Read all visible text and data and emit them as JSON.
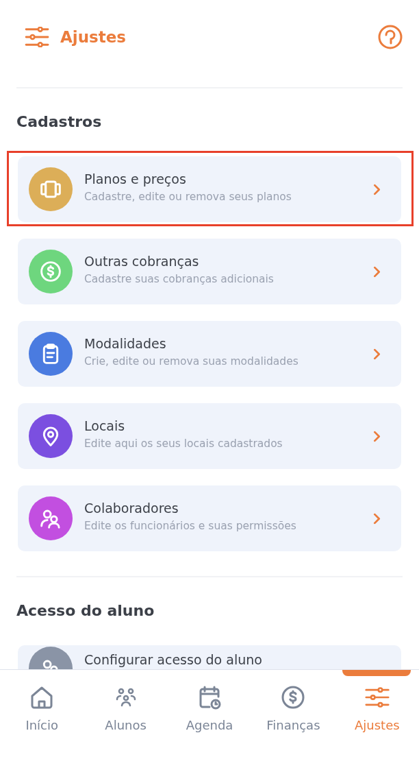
{
  "header": {
    "title": "Ajustes"
  },
  "sections": [
    {
      "title": "Cadastros",
      "items": [
        {
          "color": "#dcae58",
          "title": "Planos e preços",
          "subtitle": "Cadastre, edite ou remova seus planos",
          "highlighted": true
        },
        {
          "color": "#6ed67e",
          "title": "Outras cobranças",
          "subtitle": "Cadastre suas cobranças adicionais",
          "highlighted": false
        },
        {
          "color": "#4a7be0",
          "title": "Modalidades",
          "subtitle": "Crie, edite ou remova suas modalidades",
          "highlighted": false
        },
        {
          "color": "#7b4fe0",
          "title": "Locais",
          "subtitle": "Edite aqui os seus locais cadastrados",
          "highlighted": false
        },
        {
          "color": "#c24fe0",
          "title": "Colaboradores",
          "subtitle": "Edite os funcionários e suas permissões",
          "highlighted": false
        }
      ]
    },
    {
      "title": "Acesso do aluno",
      "items": [
        {
          "color": "#8a94a6",
          "title": "Configurar acesso do aluno",
          "highlighted": false
        }
      ]
    }
  ],
  "nav": [
    {
      "label": "Início",
      "selected": false
    },
    {
      "label": "Alunos",
      "selected": false
    },
    {
      "label": "Agenda",
      "selected": false
    },
    {
      "label": "Finanças",
      "selected": false
    },
    {
      "label": "Ajustes",
      "selected": true
    }
  ]
}
